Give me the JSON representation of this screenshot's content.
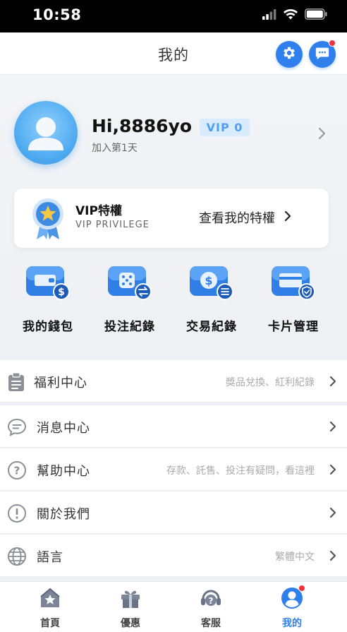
{
  "status_bar": {
    "time": "10:58"
  },
  "header": {
    "title": "我的"
  },
  "profile": {
    "greeting": "Hi,8886yo",
    "vip_level": "VIP 0",
    "join_text": "加入第1天"
  },
  "vip_card": {
    "title": "VIP特權",
    "subtitle": "VIP PRIVILEGE",
    "link": "查看我的特權"
  },
  "quick_actions": [
    {
      "label": "我的錢包",
      "icon": "wallet-icon"
    },
    {
      "label": "投注紀錄",
      "icon": "bet-record-icon"
    },
    {
      "label": "交易紀錄",
      "icon": "transaction-icon"
    },
    {
      "label": "卡片管理",
      "icon": "card-icon"
    }
  ],
  "menu": [
    {
      "label": "福利中心",
      "hint": "獎品兌換、紅利紀錄",
      "icon": "clipboard-icon"
    },
    {
      "label": "消息中心",
      "hint": "",
      "icon": "chat-bubble-icon"
    },
    {
      "label": "幫助中心",
      "hint": "存款、託售、投注有疑問，看這裡",
      "icon": "help-icon"
    },
    {
      "label": "關於我們",
      "hint": "",
      "icon": "info-icon"
    },
    {
      "label": "語言",
      "hint": "繁體中文",
      "icon": "globe-icon"
    }
  ],
  "tabbar": [
    {
      "label": "首頁",
      "icon": "home-icon"
    },
    {
      "label": "優惠",
      "icon": "gift-icon"
    },
    {
      "label": "客服",
      "icon": "support-icon"
    },
    {
      "label": "我的",
      "icon": "profile-icon",
      "active": true
    }
  ],
  "colors": {
    "accent": "#2f80ed",
    "badge": "#f0313b",
    "vip_badge_bg": "#d8ebff"
  }
}
